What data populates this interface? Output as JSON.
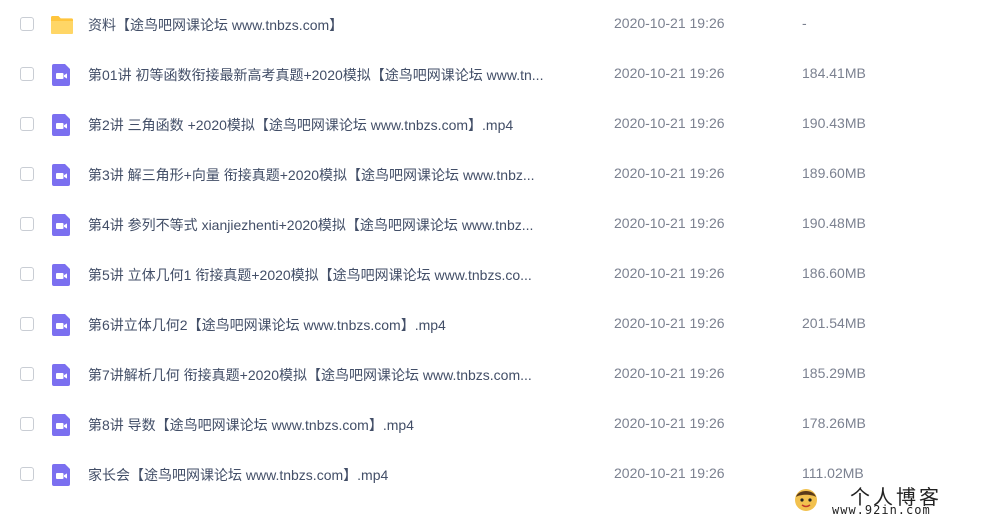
{
  "files": [
    {
      "icon": "folder-icon",
      "name": "资料【途鸟吧网课论坛 www.tnbzs.com】",
      "date": "2020-10-21 19:26",
      "size": "-"
    },
    {
      "icon": "video-file-icon",
      "name": "第01讲 初等函数衔接最新高考真题+2020模拟【途鸟吧网课论坛 www.tn...",
      "date": "2020-10-21 19:26",
      "size": "184.41MB"
    },
    {
      "icon": "video-file-icon",
      "name": "第2讲 三角函数 +2020模拟【途鸟吧网课论坛 www.tnbzs.com】.mp4",
      "date": "2020-10-21 19:26",
      "size": "190.43MB"
    },
    {
      "icon": "video-file-icon",
      "name": "第3讲 解三角形+向量  衔接真题+2020模拟【途鸟吧网课论坛 www.tnbz...",
      "date": "2020-10-21 19:26",
      "size": "189.60MB"
    },
    {
      "icon": "video-file-icon",
      "name": "第4讲 参列不等式 xianjiezhenti+2020模拟【途鸟吧网课论坛 www.tnbz...",
      "date": "2020-10-21 19:26",
      "size": "190.48MB"
    },
    {
      "icon": "video-file-icon",
      "name": "第5讲 立体几何1 衔接真题+2020模拟【途鸟吧网课论坛 www.tnbzs.co...",
      "date": "2020-10-21 19:26",
      "size": "186.60MB"
    },
    {
      "icon": "video-file-icon",
      "name": "第6讲立体几何2【途鸟吧网课论坛 www.tnbzs.com】.mp4",
      "date": "2020-10-21 19:26",
      "size": "201.54MB"
    },
    {
      "icon": "video-file-icon",
      "name": "第7讲解析几何  衔接真题+2020模拟【途鸟吧网课论坛 www.tnbzs.com...",
      "date": "2020-10-21 19:26",
      "size": "185.29MB"
    },
    {
      "icon": "video-file-icon",
      "name": "第8讲 导数【途鸟吧网课论坛 www.tnbzs.com】.mp4",
      "date": "2020-10-21 19:26",
      "size": "178.26MB"
    },
    {
      "icon": "video-file-icon",
      "name": "家长会【途鸟吧网课论坛 www.tnbzs.com】.mp4",
      "date": "2020-10-21 19:26",
      "size": "111.02MB"
    }
  ],
  "watermark": {
    "title": "个人博客",
    "url": "www.92in.com"
  },
  "colors": {
    "folder": "#ffc53d",
    "video": "#7b6ff0",
    "text": "#424e67",
    "muted": "#7b8190",
    "checkbox_border": "#c9cdd4"
  }
}
